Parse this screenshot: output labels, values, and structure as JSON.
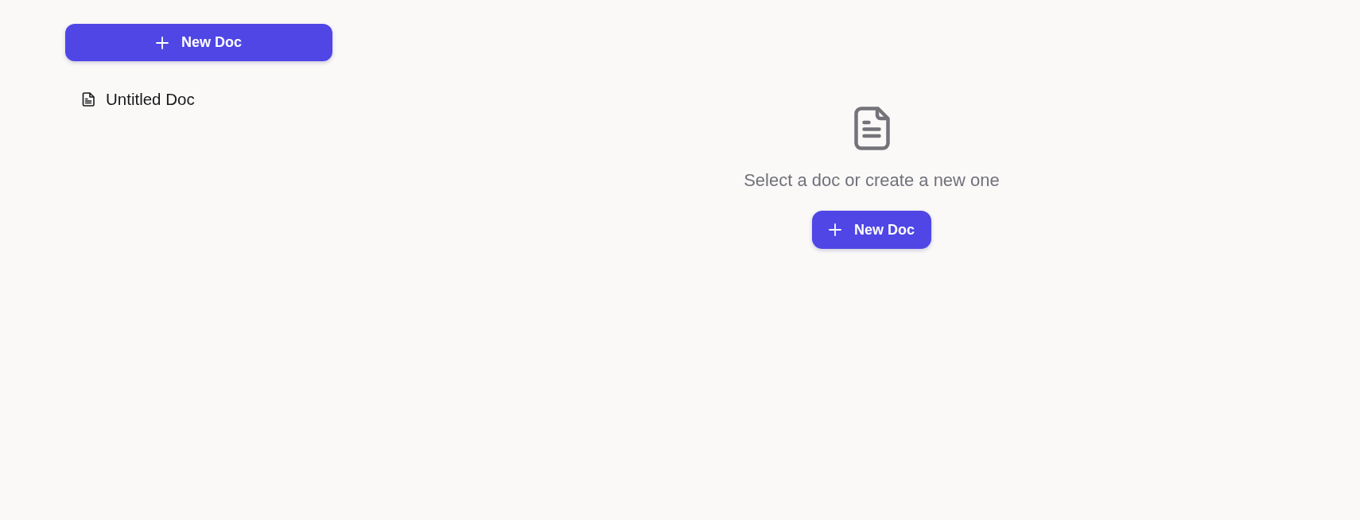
{
  "sidebar": {
    "new_button": {
      "label": "New Doc"
    },
    "docs": [
      {
        "title": "Untitled Doc",
        "selected": false
      }
    ]
  },
  "main": {
    "empty_message": "Select a doc or create a new one",
    "new_button": {
      "label": "New Doc"
    }
  }
}
